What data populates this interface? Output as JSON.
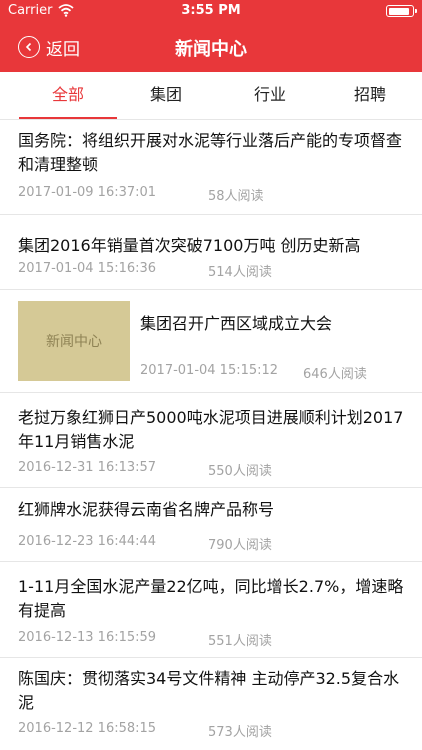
{
  "status_bar": {
    "carrier": "Carrier",
    "time": "3:55 PM",
    "battery_level": 0.9
  },
  "nav": {
    "back_label": "返回",
    "title": "新闻中心",
    "back_icon": "chevron-left-circle-icon"
  },
  "tabs": [
    {
      "label": "全部",
      "active": true
    },
    {
      "label": "集团",
      "active": false
    },
    {
      "label": "行业",
      "active": false
    },
    {
      "label": "招聘",
      "active": false
    }
  ],
  "colors": {
    "accent": "#e8373a",
    "meta_text": "#a3a3a3",
    "divider": "#e6e6e6",
    "thumbnail_bg": "#d5c996"
  },
  "news": [
    {
      "title": "国务院：将组织开展对水泥等行业落后产能的专项督查和清理整顿",
      "date": "2017-01-09 16:37:01",
      "reads": "58人阅读"
    },
    {
      "title": "集团2016年销量首次突破7100万吨 创历史新高",
      "date": "2017-01-04 15:16:36",
      "reads": "514人阅读"
    },
    {
      "title": "集团召开广西区域成立大会",
      "date": "2017-01-04 15:15:12",
      "reads": "646人阅读",
      "thumbnail_text": "新闻中心"
    },
    {
      "title": "老挝万象红狮日产5000吨水泥项目进展顺利计划2017年11月销售水泥",
      "date": "2016-12-31 16:13:57",
      "reads": "550人阅读"
    },
    {
      "title": "红狮牌水泥获得云南省名牌产品称号",
      "date": "2016-12-23 16:44:44",
      "reads": "790人阅读"
    },
    {
      "title": "1-11月全国水泥产量22亿吨，同比增长2.7%，增速略有提高",
      "date": "2016-12-13 16:15:59",
      "reads": "551人阅读"
    },
    {
      "title": "陈国庆：贯彻落实34号文件精神 主动停产32.5复合水泥",
      "date": "2016-12-12 16:58:15",
      "reads": "573人阅读"
    }
  ]
}
